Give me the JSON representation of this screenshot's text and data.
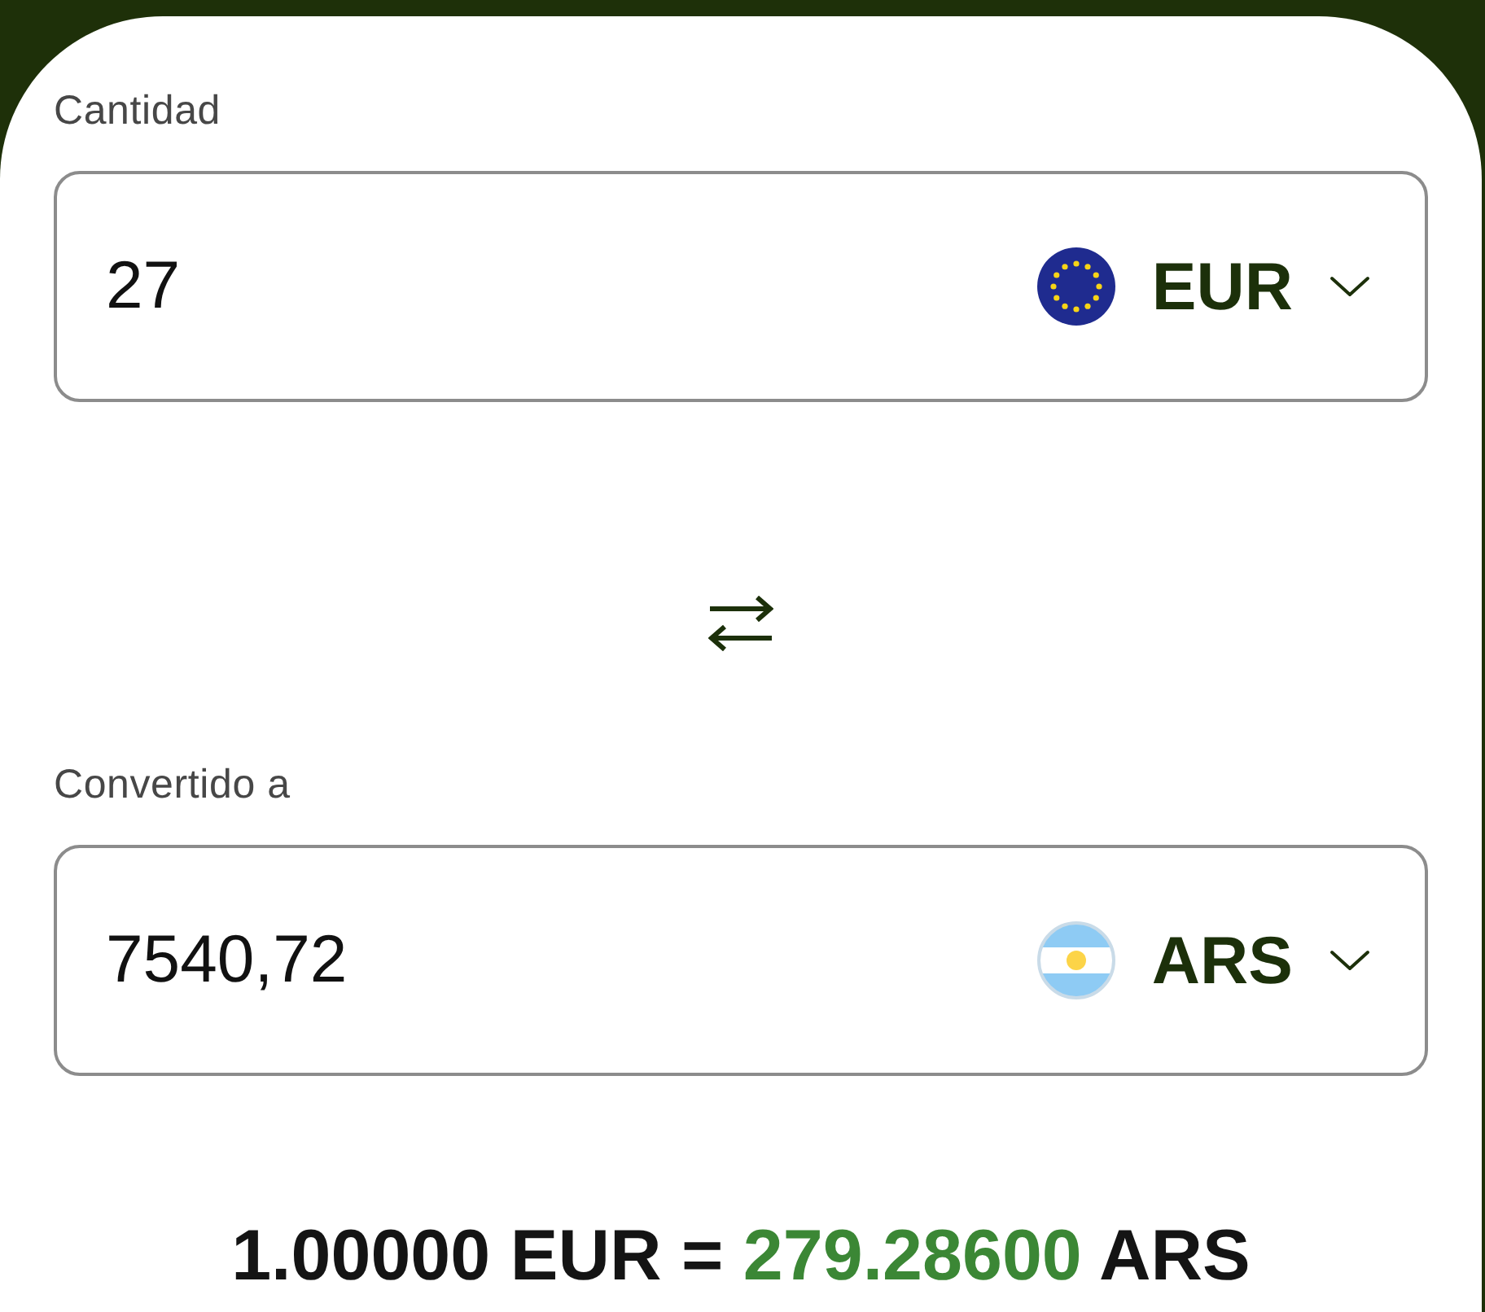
{
  "converter": {
    "fields": [
      {
        "label": "Cantidad",
        "value": "27",
        "currency": "EUR"
      },
      {
        "label": "Convertido a",
        "value": "7540,72",
        "currency": "ARS"
      }
    ],
    "rate": {
      "base": "1.00000 EUR =",
      "value": "279.28600",
      "quote": "ARS"
    }
  }
}
